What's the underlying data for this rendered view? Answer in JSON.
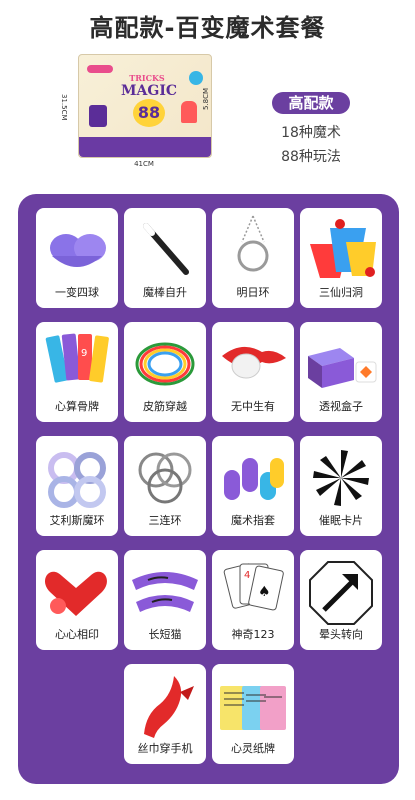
{
  "title": "高配款-百变魔术套餐",
  "product": {
    "box_title_line1": "TRICKS",
    "box_title_line2": "MAGIC",
    "box_number": "88",
    "dim_width": "41CM",
    "dim_height": "31.5CM",
    "dim_depth": "5.8CM"
  },
  "badge": "高配款",
  "info": [
    "18种魔术",
    "88种玩法"
  ],
  "items": [
    {
      "label": "一变四球"
    },
    {
      "label": "魔棒自升"
    },
    {
      "label": "明日环"
    },
    {
      "label": "三仙归洞"
    },
    {
      "label": "心算骨牌"
    },
    {
      "label": "皮筋穿越"
    },
    {
      "label": "无中生有"
    },
    {
      "label": "透视盒子"
    },
    {
      "label": "艾利斯魔环"
    },
    {
      "label": "三连环"
    },
    {
      "label": "魔术指套"
    },
    {
      "label": "催眠卡片"
    },
    {
      "label": "心心相印"
    },
    {
      "label": "长短猫"
    },
    {
      "label": "神奇123"
    },
    {
      "label": "晕头转向"
    },
    {
      "label": "丝巾穿手机"
    },
    {
      "label": "心灵纸牌"
    }
  ],
  "colors": {
    "panel": "#6b3fa0",
    "card": "#ffffff",
    "accent": "#ffd33a"
  }
}
